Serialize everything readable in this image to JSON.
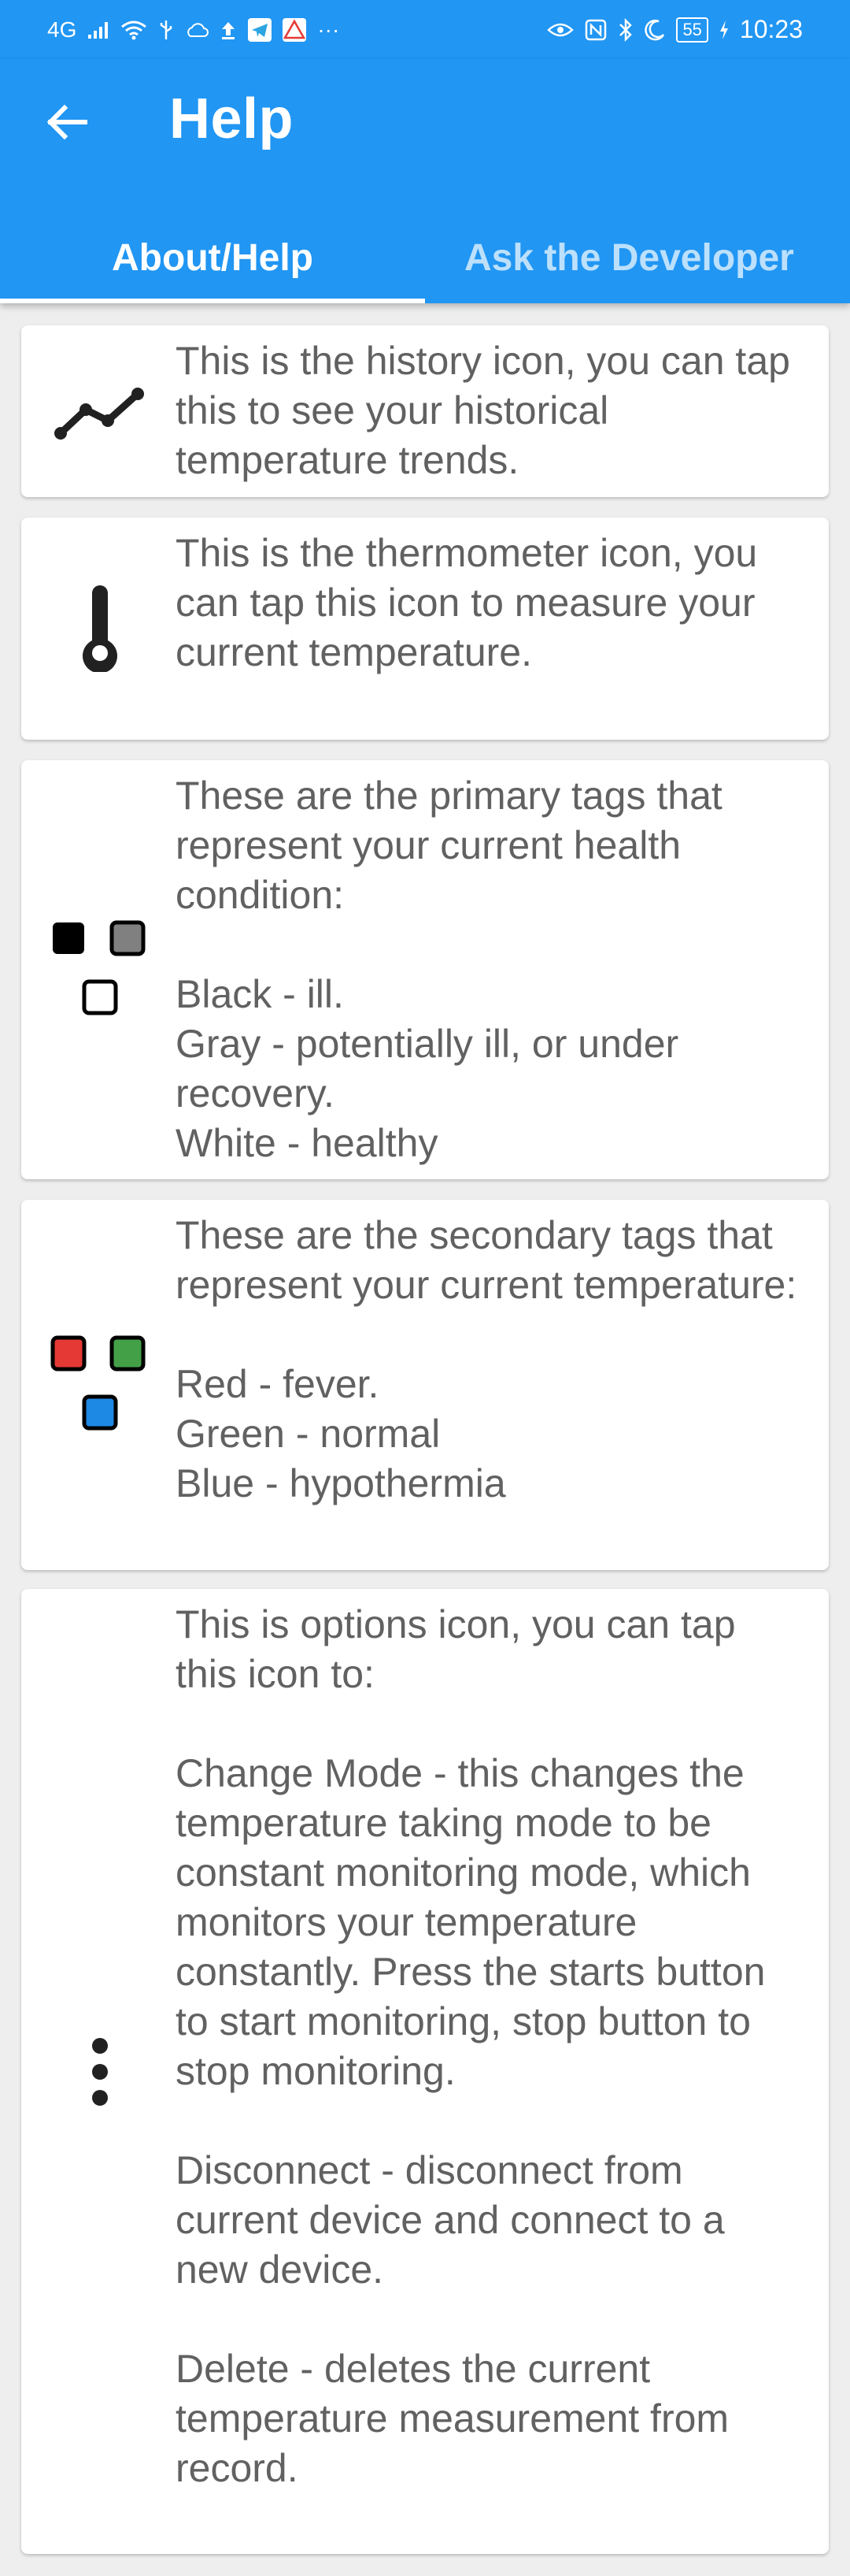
{
  "status_bar": {
    "network": "4G",
    "battery": "55",
    "time": "10:23"
  },
  "app_bar": {
    "title": "Help",
    "back_icon": "arrow-left-icon"
  },
  "tabs": [
    {
      "label": "About/Help",
      "selected": true
    },
    {
      "label": "Ask the Developer",
      "selected": false
    }
  ],
  "help_items": [
    {
      "icon": "history-icon",
      "text": "This is the history icon, you can tap this to see your historical temperature trends."
    },
    {
      "icon": "thermometer-icon",
      "text": "This is the thermometer icon, you can tap this icon to measure your current temperature."
    },
    {
      "icon": "primary-tags-icon",
      "text": "These are the primary tags that represent your current health condition:\n\nBlack - ill.\nGray - potentially ill, or under recovery.\nWhite - healthy"
    },
    {
      "icon": "secondary-tags-icon",
      "text": "These are the secondary tags that represent your current temperature:\n\nRed - fever.\nGreen - normal\nBlue - hypothermia"
    },
    {
      "icon": "options-icon",
      "text": "This is options icon, you can tap this icon to:\n\nChange Mode - this changes the temperature taking mode to be constant monitoring mode, which monitors your temperature constantly. Press the starts button to start monitoring, stop button to stop monitoring.\n\nDisconnect - disconnect from current device and connect to a new device.\n\nDelete - deletes the current temperature measurement from record."
    }
  ],
  "colors": {
    "primary": "#2196f3",
    "tag_black": "#000000",
    "tag_gray": "#808080",
    "tag_white": "#ffffff",
    "tag_red": "#e53935",
    "tag_green": "#43a047",
    "tag_blue": "#1e88e5",
    "body_text": "#616161"
  }
}
